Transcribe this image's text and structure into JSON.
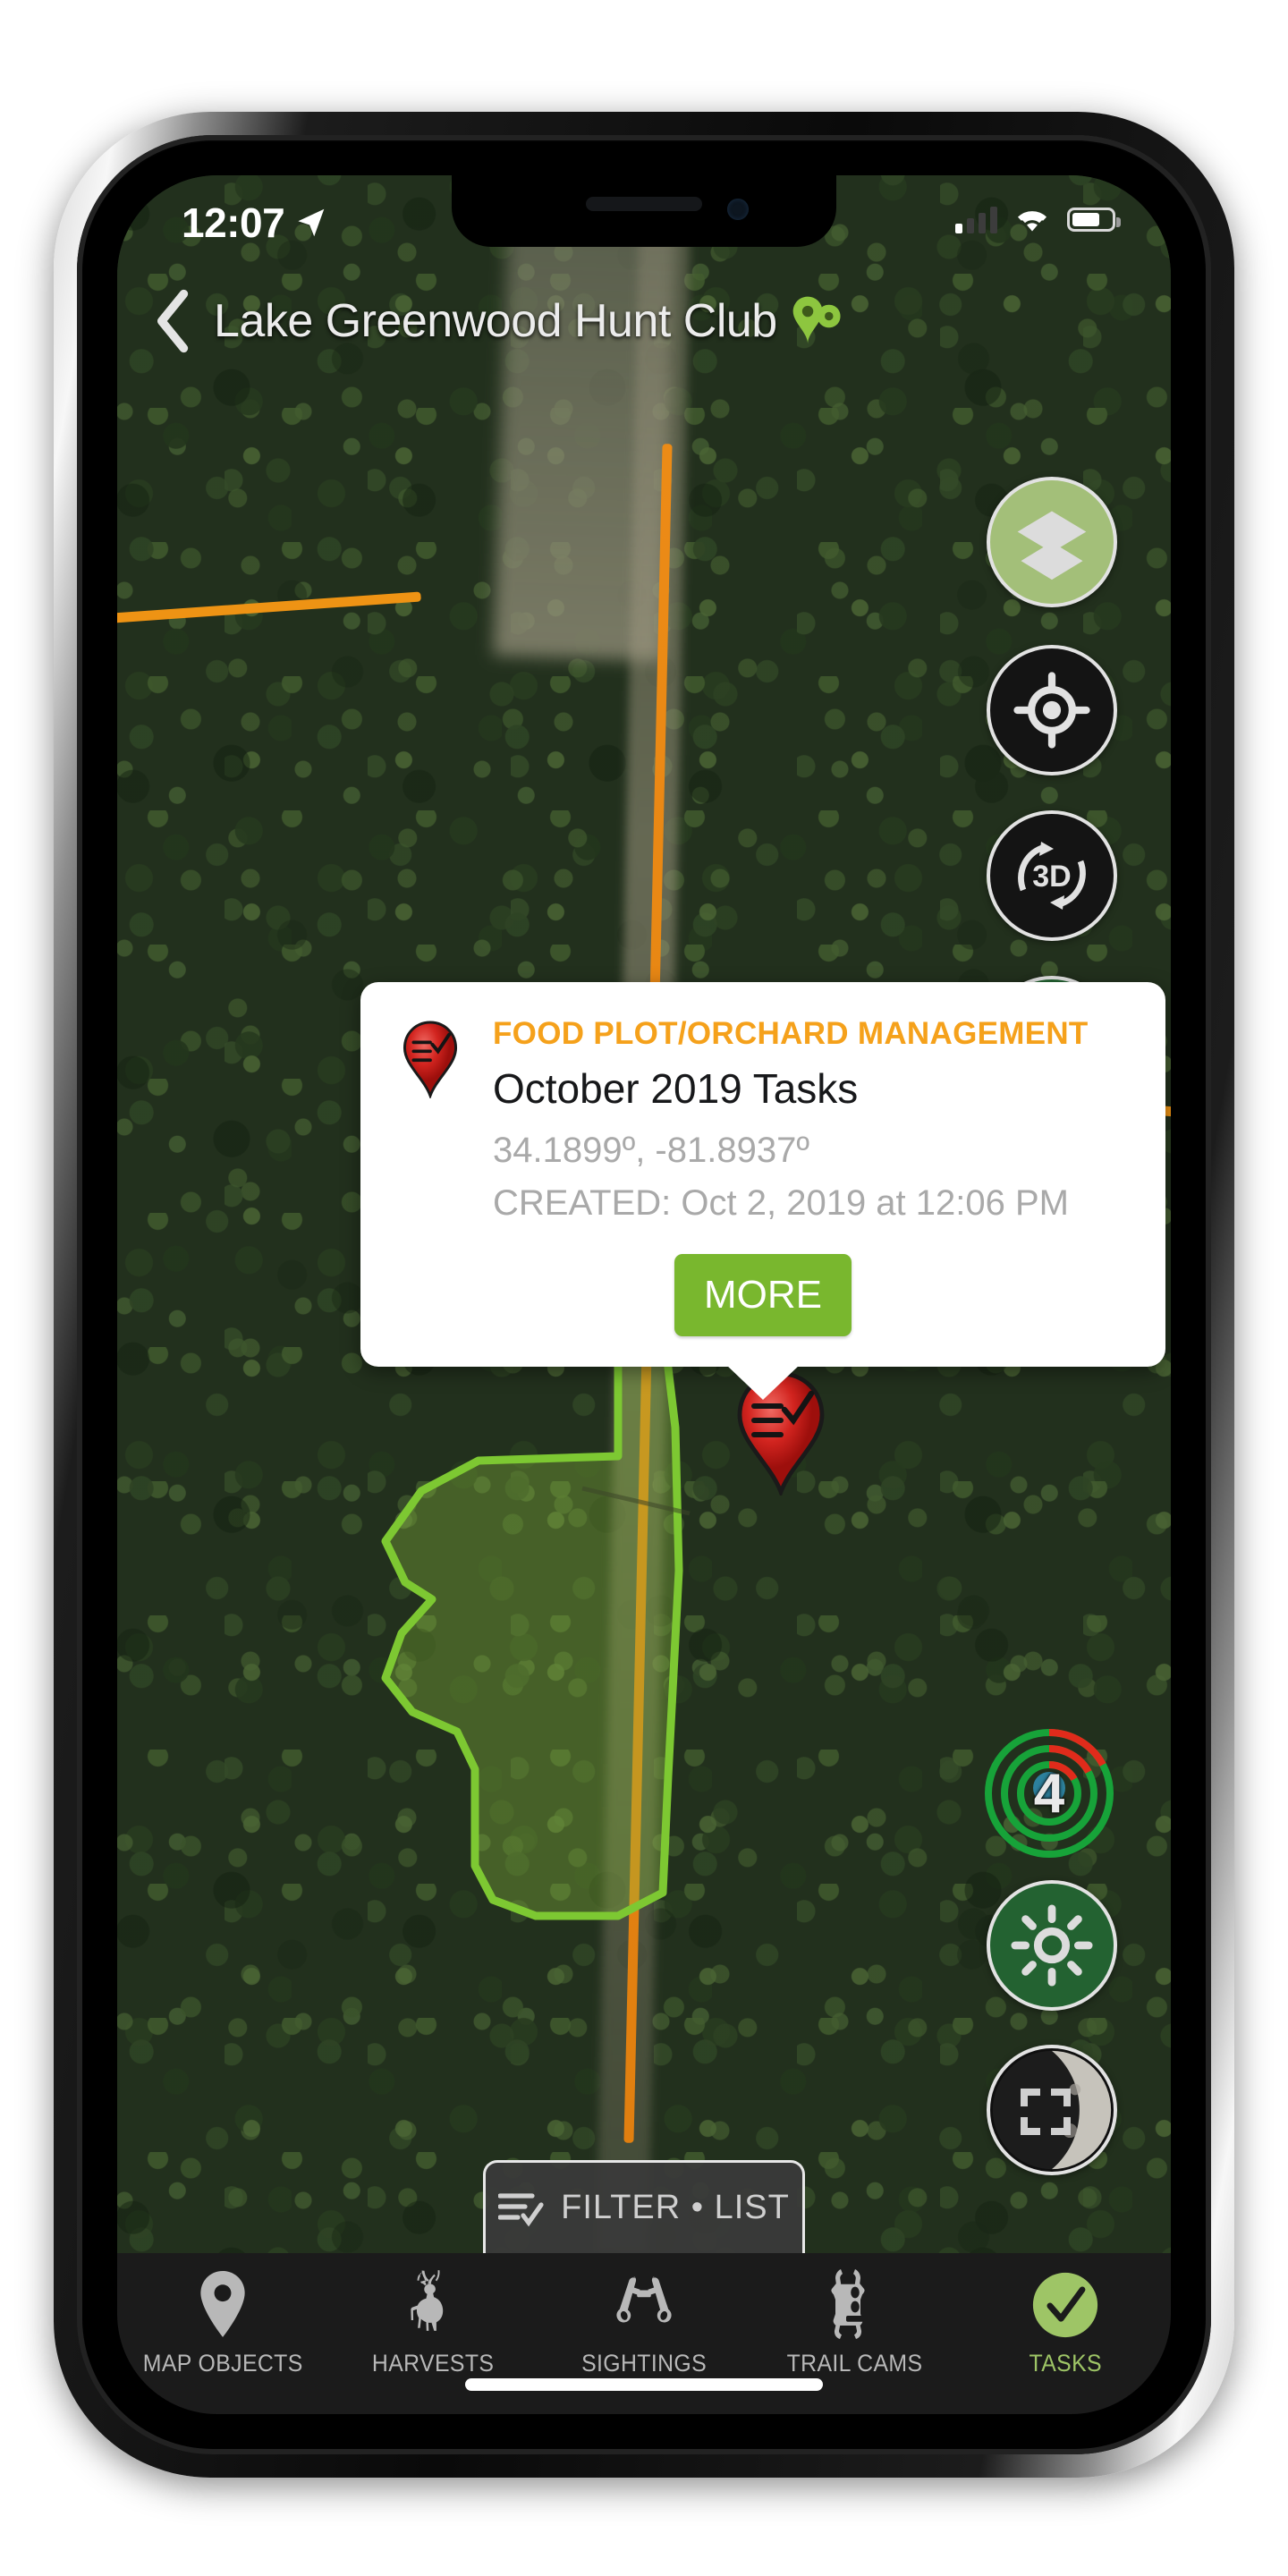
{
  "status_bar": {
    "time": "12:07",
    "location_arrow_icon": "location-arrow-icon",
    "signal_icon": "cellular-signal-icon",
    "signal_bars_filled": 1,
    "signal_bars_total": 4,
    "wifi_icon": "wifi-icon",
    "battery_icon": "battery-icon",
    "battery_level_percent": 72
  },
  "header": {
    "back_icon": "chevron-left-icon",
    "title": "Lake Greenwood Hunt Club",
    "pins_icon": "double-map-pin-icon"
  },
  "map": {
    "basemap": "satellite",
    "accent_green": "#7dc832",
    "trail_orange": "#ee8913",
    "controls": [
      {
        "name": "layers-button",
        "icon": "layers-icon",
        "style": "olive"
      },
      {
        "name": "locate-button",
        "icon": "crosshair-gps-icon",
        "style": "dark"
      },
      {
        "name": "three-d-button",
        "icon": "3d-rotate-icon",
        "label": "3D",
        "style": "dark"
      },
      {
        "name": "hidden-button-1",
        "icon": "navigation-arrow-icon",
        "style": "green"
      },
      {
        "name": "hidden-button-2",
        "icon": "check-icon",
        "style": "green"
      },
      {
        "name": "sun-button",
        "icon": "sun-icon",
        "style": "green"
      },
      {
        "name": "moon-button",
        "icon": "moon-phase-icon",
        "style": "dark"
      }
    ],
    "wind_indicator": {
      "value": "4",
      "ring_green": "#17a339",
      "ring_red": "#e02b1b"
    },
    "fullscreen_icon": "expand-fullscreen-icon",
    "marker": {
      "icon": "task-pin-icon",
      "color": "#d2241f"
    }
  },
  "callout": {
    "pin_icon": "task-pin-icon",
    "category": "FOOD PLOT/ORCHARD MANAGEMENT",
    "category_color": "#f5a11b",
    "title": "October 2019 Tasks",
    "coordinates": "34.1899º, -81.8937º",
    "created": "CREATED: Oct 2, 2019 at 12:06 PM",
    "more_button_label": "MORE",
    "more_button_color": "#79b72e"
  },
  "filter_bar": {
    "icon": "filter-list-icon",
    "label": "FILTER • LIST"
  },
  "tab_bar": {
    "active_color": "#9ec566",
    "tabs": [
      {
        "label": "MAP OBJECTS",
        "icon": "map-pin-icon",
        "active": false
      },
      {
        "label": "HARVESTS",
        "icon": "deer-icon",
        "active": false
      },
      {
        "label": "SIGHTINGS",
        "icon": "binoculars-icon",
        "active": false
      },
      {
        "label": "TRAIL CAMS",
        "icon": "trail-camera-icon",
        "active": false
      },
      {
        "label": "TASKS",
        "icon": "check-circle-icon",
        "active": true
      }
    ]
  }
}
